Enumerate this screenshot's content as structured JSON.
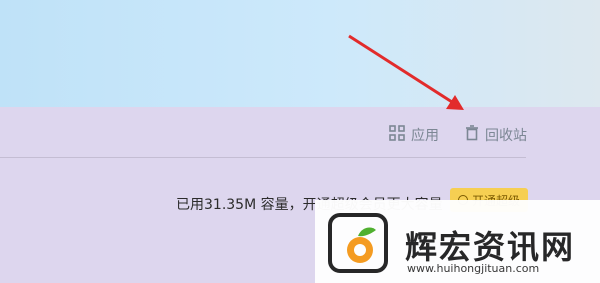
{
  "toolbar": {
    "apps_label": "应用",
    "recycle_label": "回收站"
  },
  "storage": {
    "quota_text": "已用31.35M 容量，开通超级会员更大容量",
    "upgrade_label": "开通超级"
  },
  "watermark": {
    "title": "辉宏资讯网",
    "url": "www.huihongjituan.com"
  },
  "colors": {
    "banner": "#cde9fb",
    "panel": "#ddd6ee",
    "accent_arrow": "#e22b2b",
    "upgrade_button": "#f6cf52"
  }
}
